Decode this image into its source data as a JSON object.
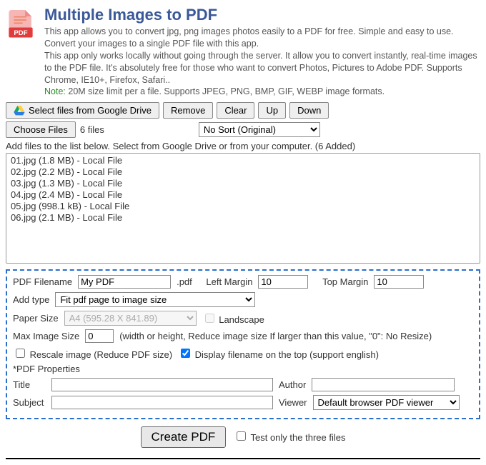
{
  "header": {
    "title": "Multiple Images to PDF",
    "desc1": "This app allows you to convert jpg, png images photos easily to a PDF for free. Simple and easy to use. Convert your images to a single PDF file with this app.",
    "desc2": "This app only works locally without going through the server. It allow you to convert instantly, real-time images to the PDF file. It's absolutely free for those who want to convert Photos, Pictures to Adobe PDF. Supports Chrome, IE10+, Firefox, Safari..",
    "note_label": "Note:",
    "note_text": " 20M size limit per a file. Supports JPEG, PNG, BMP, GIF, WEBP image formats."
  },
  "toolbar": {
    "google_drive": "Select files from Google Drive",
    "remove": "Remove",
    "clear": "Clear",
    "up": "Up",
    "down": "Down"
  },
  "filechooser": {
    "button": "Choose Files",
    "status": "6 files"
  },
  "sort": {
    "selected": "No Sort (Original)"
  },
  "addnote": "Add files to the list below. Select from Google Drive or from your computer. (6 Added)",
  "files": [
    "01.jpg (1.8 MB) - Local File",
    "02.jpg (2.2 MB) - Local File",
    "03.jpg (1.3 MB) - Local File",
    "04.jpg (2.4 MB) - Local File",
    "05.jpg (998.1 kB) - Local File",
    "06.jpg (2.1 MB) - Local File"
  ],
  "options": {
    "filename_label": "PDF Filename",
    "filename_value": "My PDF",
    "ext": ".pdf",
    "left_margin_label": "Left Margin",
    "left_margin_value": "10",
    "top_margin_label": "Top Margin",
    "top_margin_value": "10",
    "add_type_label": "Add type",
    "add_type_value": "Fit pdf page to image size",
    "paper_size_label": "Paper Size",
    "paper_size_value": "A4 (595.28 X 841.89)",
    "landscape_label": "Landscape",
    "max_image_label": "Max Image Size",
    "max_image_value": "0",
    "max_image_hint": "(width or height, Reduce image size If larger than this value, \"0\": No Resize)",
    "rescale_label": "Rescale image (Reduce PDF size)",
    "display_filename_label": "Display filename on the top (support english)",
    "props_header": "*PDF Properties",
    "title_label": "Title",
    "author_label": "Author",
    "subject_label": "Subject",
    "viewer_label": "Viewer",
    "viewer_value": "Default browser PDF viewer"
  },
  "footer": {
    "create": "Create PDF",
    "test_label": "Test only the three files"
  }
}
